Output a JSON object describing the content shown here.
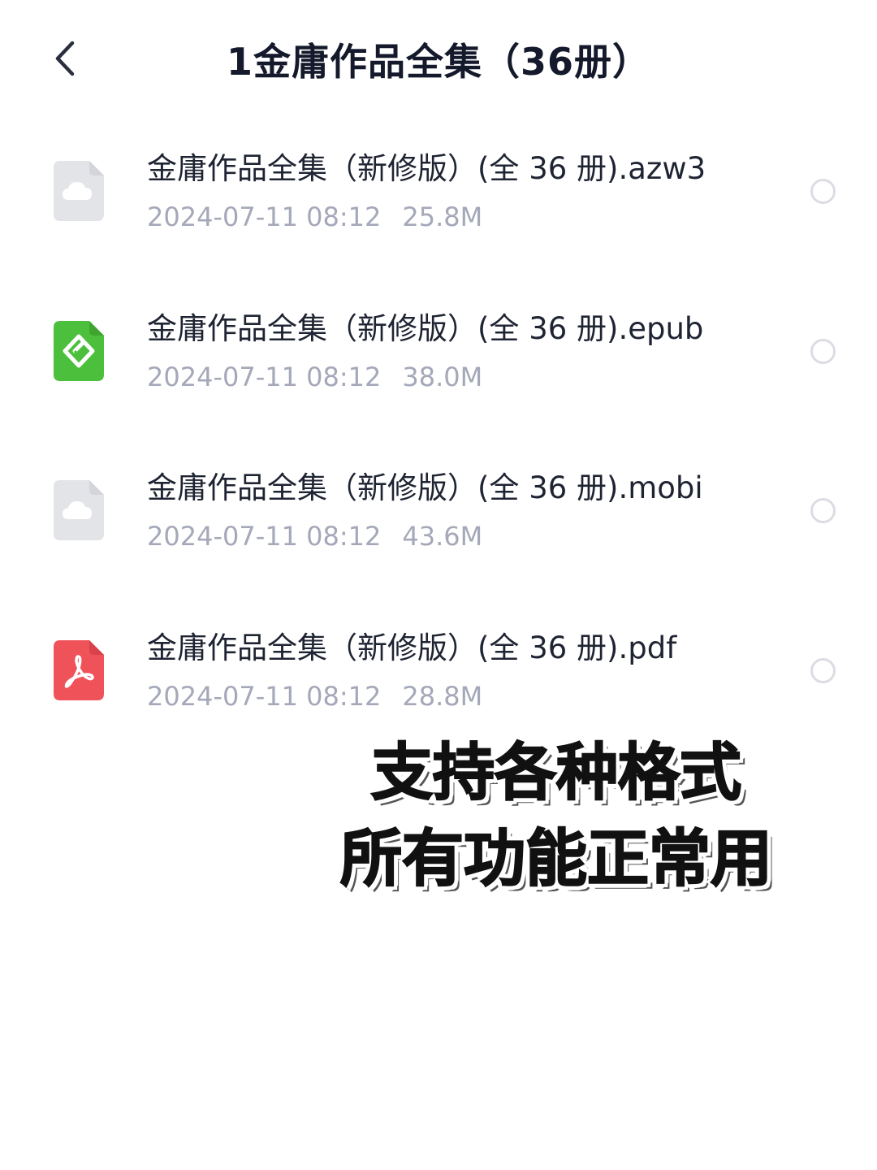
{
  "header": {
    "back_icon": "chevron-left-icon",
    "title": "1金庸作品全集（36册）"
  },
  "files": [
    {
      "name": "金庸作品全集（新修版）(全 36 册).azw3",
      "date": "2024-07-11 08:12",
      "size": "25.8M",
      "icon": "cloud-file-icon",
      "icon_color": "#e3e4e8"
    },
    {
      "name": "金庸作品全集（新修版）(全 36 册).epub",
      "date": "2024-07-11 08:12",
      "size": "38.0M",
      "icon": "epub-file-icon",
      "icon_color": "#4cbf3c"
    },
    {
      "name": "金庸作品全集（新修版）(全 36 册).mobi",
      "date": "2024-07-11 08:12",
      "size": "43.6M",
      "icon": "cloud-file-icon",
      "icon_color": "#e3e4e8"
    },
    {
      "name": "金庸作品全集（新修版）(全 36 册).pdf",
      "date": "2024-07-11 08:12",
      "size": "28.8M",
      "icon": "pdf-file-icon",
      "icon_color": "#f0525a"
    }
  ],
  "caption": {
    "line1": "支持各种格式",
    "line2": "所有功能正常用"
  },
  "colors": {
    "title_text": "#141a2b",
    "meta_text": "#a4a8b8",
    "radio_border": "#dcdde3"
  }
}
